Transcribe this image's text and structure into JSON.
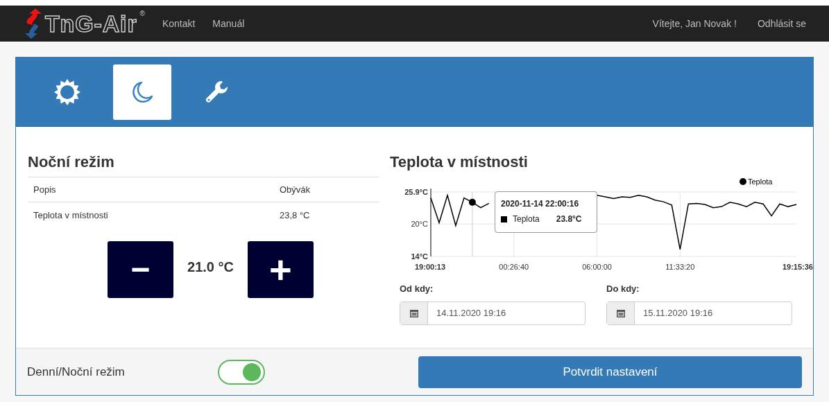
{
  "navbar": {
    "logo": "TnG-Air",
    "logo_mark": "®",
    "links": [
      "Kontakt",
      "Manuál"
    ],
    "user": "Vítejte, Jan Novak !",
    "logout": "Odhlásit se"
  },
  "tabs": [
    {
      "kind": "sun",
      "selected": false
    },
    {
      "kind": "moon",
      "selected": true
    },
    {
      "kind": "wrench",
      "selected": false
    }
  ],
  "left": {
    "title": "Noční režim",
    "table": {
      "columns": [
        "Popis",
        "Obývák"
      ],
      "rows": [
        [
          "Teplota v místnosti",
          "23,8 °C"
        ]
      ]
    },
    "minus": "−",
    "plus": "+",
    "setpoint": "21.0 °C"
  },
  "right": {
    "title": "Teplota v místnosti",
    "chart_data": {
      "type": "line",
      "categories": [
        "19:00:13",
        null,
        null,
        null,
        null,
        null,
        null,
        null,
        null,
        null,
        "00:26:40",
        null,
        null,
        null,
        null,
        null,
        null,
        null,
        null,
        null,
        "06:00:00",
        null,
        null,
        null,
        null,
        null,
        null,
        null,
        null,
        null,
        "11:33:20",
        null,
        null,
        null,
        null,
        null,
        null,
        null,
        null,
        null,
        null,
        null,
        null,
        null,
        "19:15:36"
      ],
      "series": [
        {
          "name": "Teplota",
          "color": "#000000",
          "values": [
            24.8,
            20.2,
            25.3,
            19.7,
            24.8,
            24.0,
            23.0,
            23.8,
            null,
            null,
            null,
            null,
            null,
            null,
            null,
            null,
            null,
            null,
            null,
            null,
            25.3,
            25.0,
            24.7,
            25.0,
            24.9,
            25.3,
            25.0,
            24.4,
            24.1,
            23.5,
            15.3,
            23.7,
            23.8,
            23.6,
            23.0,
            23.2,
            24.0,
            23.7,
            23.2,
            24.0,
            23.7,
            21.5,
            23.7,
            23.2,
            23.6
          ]
        }
      ],
      "grid": true,
      "ylim": [
        14,
        25.9
      ],
      "yticks": [
        {
          "value": 14,
          "label": "14°C"
        },
        {
          "value": 20,
          "label": "20°C"
        },
        {
          "value": 25.9,
          "label": "25.9°C"
        }
      ]
    },
    "tooltip": {
      "title": "2020-11-14 22:00:16",
      "label": "Teplota",
      "value": "23.8°C"
    },
    "from": {
      "label": "Od kdy:",
      "value": "14.11.2020 19:16"
    },
    "to": {
      "label": "Do kdy:",
      "value": "15.11.2020 19:16"
    }
  },
  "footer": {
    "toggle_label": "Denní/Noční režim",
    "toggle_on": true,
    "confirm": "Potvrdit nastavení"
  }
}
